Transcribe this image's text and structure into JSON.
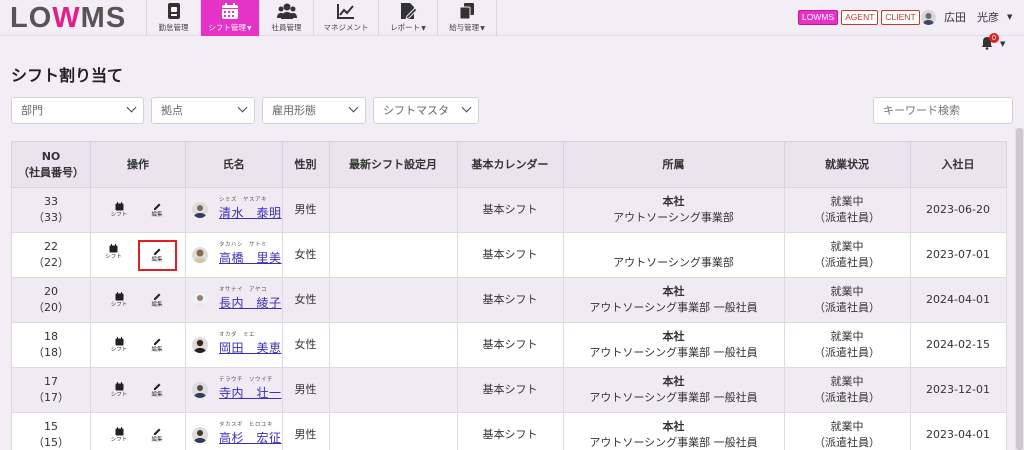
{
  "logo": {
    "prefix": "LO",
    "mark": "W",
    "suffix": "MS"
  },
  "nav": [
    {
      "label": "勤怠管理",
      "icon": "clipboard-icon",
      "active": false,
      "dropdown": false
    },
    {
      "label": "シフト管理",
      "icon": "calendar-icon",
      "active": true,
      "dropdown": true
    },
    {
      "label": "社員管理",
      "icon": "users-icon",
      "active": false,
      "dropdown": false
    },
    {
      "label": "マネジメント",
      "icon": "chart-line-icon",
      "active": false,
      "dropdown": false
    },
    {
      "label": "レポート",
      "icon": "report-edit-icon",
      "active": false,
      "dropdown": true
    },
    {
      "label": "給与管理",
      "icon": "copy-icon",
      "active": false,
      "dropdown": true
    }
  ],
  "badges": [
    "LOWMS",
    "AGENT",
    "CLIENT"
  ],
  "user": {
    "name": "広田　光彦"
  },
  "notifications": {
    "count": "0"
  },
  "page": {
    "title": "シフト割り当て"
  },
  "filters": {
    "department": "部門",
    "location": "拠点",
    "employment_type": "雇用形態",
    "shift_master": "シフトマスタ",
    "keyword_placeholder": "キーワード検索"
  },
  "table": {
    "headers": {
      "no": "NO",
      "no_sub": "（社員番号）",
      "ops": "操作",
      "name": "氏名",
      "gender": "性別",
      "latest_shift": "最新シフト設定月",
      "calendar": "基本カレンダー",
      "affiliation": "所属",
      "status": "就業状況",
      "join_date": "入社日"
    },
    "op_labels": {
      "shift": "シフト",
      "edit": "編集"
    },
    "rows": [
      {
        "no": "33",
        "emp": "（33）",
        "kana": "シミズ　ヤスアキ",
        "name": "清水　泰明",
        "gender": "男性",
        "latest": "",
        "calendar": "基本シフト",
        "aff1": "本社",
        "aff2": "アウトソーシング事業部",
        "status1": "就業中",
        "status2": "（派遣社員）",
        "joined": "2023-06-20"
      },
      {
        "no": "22",
        "emp": "（22）",
        "kana": "タカハシ　サトミ",
        "name": "高橋　里美",
        "gender": "女性",
        "latest": "",
        "calendar": "基本シフト",
        "aff1": "",
        "aff2": "アウトソーシング事業部",
        "status1": "就業中",
        "status2": "（派遣社員）",
        "joined": "2023-07-01"
      },
      {
        "no": "20",
        "emp": "（20）",
        "kana": "オサナイ　アヤコ",
        "name": "長内　綾子",
        "gender": "女性",
        "latest": "",
        "calendar": "基本シフト",
        "aff1": "本社",
        "aff2": "アウトソーシング事業部 一般社員",
        "status1": "就業中",
        "status2": "（派遣社員）",
        "joined": "2024-04-01"
      },
      {
        "no": "18",
        "emp": "（18）",
        "kana": "オカダ　ミエ",
        "name": "岡田　美恵",
        "gender": "女性",
        "latest": "",
        "calendar": "基本シフト",
        "aff1": "本社",
        "aff2": "アウトソーシング事業部 一般社員",
        "status1": "就業中",
        "status2": "（派遣社員）",
        "joined": "2024-02-15"
      },
      {
        "no": "17",
        "emp": "（17）",
        "kana": "テラウチ　ソウイチ",
        "name": "寺内　壮一",
        "gender": "男性",
        "latest": "",
        "calendar": "基本シフト",
        "aff1": "本社",
        "aff2": "アウトソーシング事業部 一般社員",
        "status1": "就業中",
        "status2": "（派遣社員）",
        "joined": "2023-12-01"
      },
      {
        "no": "15",
        "emp": "（15）",
        "kana": "タカスギ　ヒロユキ",
        "name": "高杉　宏征",
        "gender": "男性",
        "latest": "",
        "calendar": "基本シフト",
        "aff1": "本社",
        "aff2": "アウトソーシング事業部 一般社員",
        "status1": "就業中",
        "status2": "（派遣社員）",
        "joined": "2023-04-01"
      }
    ]
  },
  "colors": {
    "accent": "#e533c8",
    "link": "#3b2fb8",
    "highlight": "#e02020"
  }
}
